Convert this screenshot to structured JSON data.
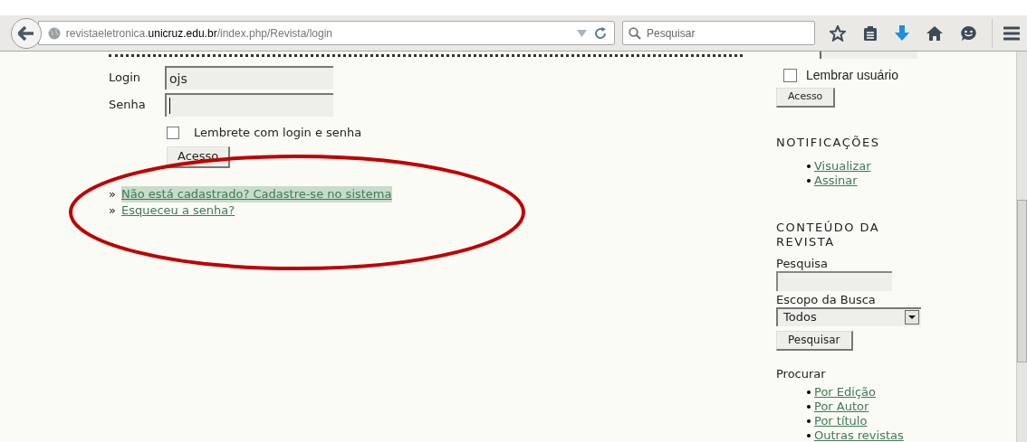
{
  "browser": {
    "url": {
      "prefix": "revistaeletronica.",
      "domain": "unicruz.edu.br",
      "path": "/index.php/Revista/login"
    },
    "search_placeholder": "Pesquisar"
  },
  "login_form": {
    "fields": [
      {
        "label": "Login",
        "value": "ojs"
      },
      {
        "label": "Senha"
      }
    ],
    "remember": {
      "label": "Lembrete com login e senha",
      "checked": false
    },
    "submit": "Acesso",
    "links": [
      {
        "bullet": "»",
        "text": "Não está cadastrado? Cadastre-se no sistema",
        "highlighted": true
      },
      {
        "bullet": "»",
        "text": "Esqueceu a senha?",
        "highlighted": false
      }
    ]
  },
  "sidebar": {
    "remember": {
      "label": "Lembrar usuário",
      "checked": false
    },
    "login_button": "Acesso",
    "notifications": {
      "title": "NOTIFICAÇÕES",
      "links": [
        "Visualizar",
        "Assinar"
      ]
    },
    "content": {
      "title": "CONTEÚDO DA REVISTA",
      "search_label": "Pesquisa",
      "scope_label": "Escopo da Busca",
      "scope_value": "Todos",
      "search_button": "Pesquisar",
      "browse_title": "Procurar",
      "browse_links": [
        "Por Edição",
        "Por Autor",
        "Por título",
        "Outras revistas"
      ]
    }
  }
}
